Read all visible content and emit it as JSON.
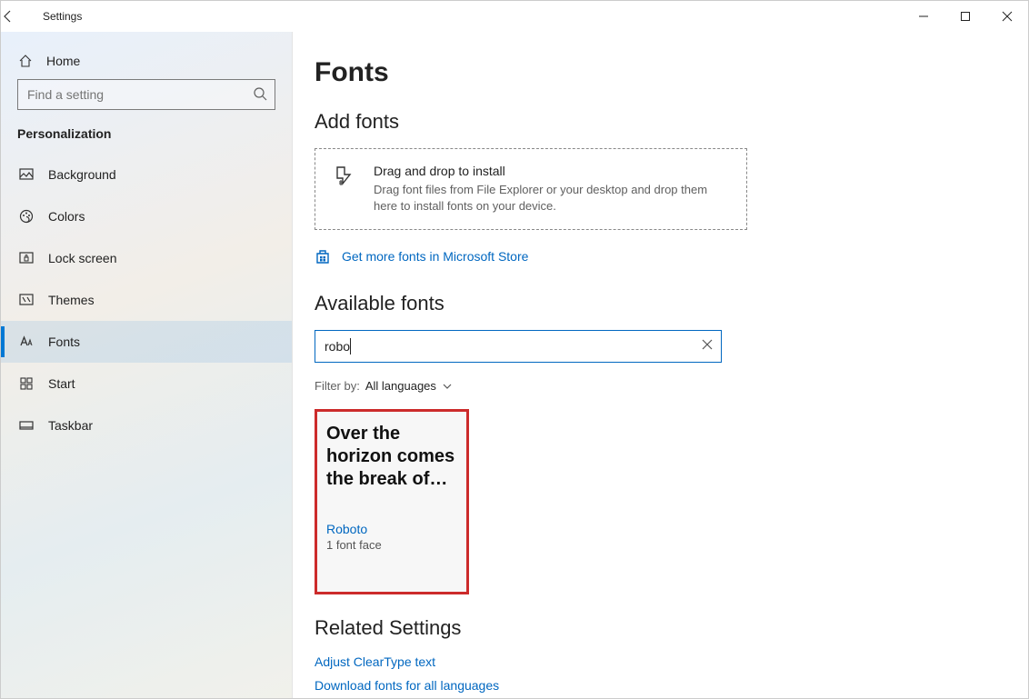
{
  "window": {
    "title": "Settings"
  },
  "sidebar": {
    "home_label": "Home",
    "search_placeholder": "Find a setting",
    "category": "Personalization",
    "items": [
      {
        "label": "Background",
        "icon": "background-icon"
      },
      {
        "label": "Colors",
        "icon": "colors-icon"
      },
      {
        "label": "Lock screen",
        "icon": "lockscreen-icon"
      },
      {
        "label": "Themes",
        "icon": "themes-icon"
      },
      {
        "label": "Fonts",
        "icon": "fonts-icon"
      },
      {
        "label": "Start",
        "icon": "start-icon"
      },
      {
        "label": "Taskbar",
        "icon": "taskbar-icon"
      }
    ],
    "active_index": 4
  },
  "main": {
    "title": "Fonts",
    "add_fonts": {
      "heading": "Add fonts",
      "drop_title": "Drag and drop to install",
      "drop_desc": "Drag font files from File Explorer or your desktop and drop them here to install fonts on your device.",
      "store_link": "Get more fonts in Microsoft Store"
    },
    "available": {
      "heading": "Available fonts",
      "search_value": "robo",
      "filter_label": "Filter by:",
      "filter_value": "All languages"
    },
    "font_card": {
      "preview": "Over the horizon comes the break of…",
      "name": "Roboto",
      "faces": "1 font face"
    },
    "related": {
      "heading": "Related Settings",
      "links": [
        "Adjust ClearType text",
        "Download fonts for all languages"
      ]
    }
  }
}
